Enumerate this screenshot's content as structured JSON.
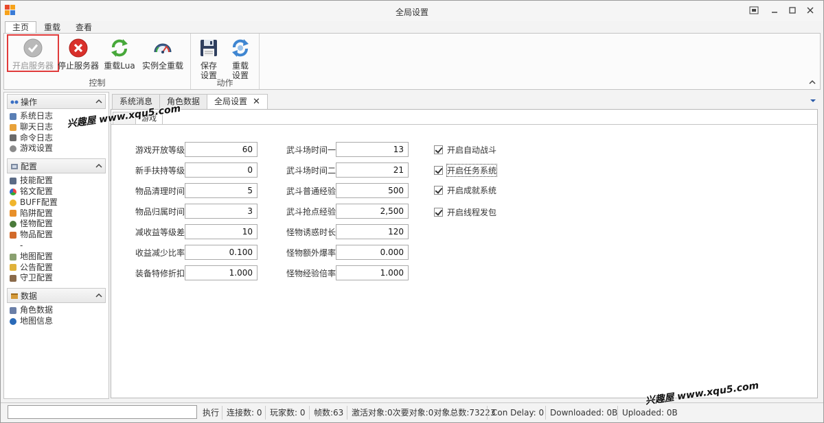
{
  "window": {
    "title": "全局设置"
  },
  "ribbon": {
    "tabs": [
      {
        "label": "主页",
        "active": true
      },
      {
        "label": "重载",
        "active": false
      },
      {
        "label": "查看",
        "active": false
      }
    ],
    "groups": {
      "control": {
        "label": "控制",
        "buttons": [
          {
            "label": "开启服务器",
            "icon": "check-circle-icon",
            "disabled": true
          },
          {
            "label": "停止服务器",
            "icon": "stop-x-icon",
            "disabled": false
          },
          {
            "label": "重载Lua",
            "icon": "refresh-green-icon",
            "disabled": false
          },
          {
            "label": "实例全重载",
            "icon": "speedometer-icon",
            "disabled": false
          }
        ]
      },
      "action": {
        "label": "动作",
        "buttons": [
          {
            "label1": "保存",
            "label2": "设置",
            "icon": "floppy-save-icon"
          },
          {
            "label1": "重载",
            "label2": "设置",
            "icon": "reload-settings-icon"
          }
        ]
      }
    }
  },
  "sidebar": {
    "groups": [
      {
        "title": "操作",
        "items": [
          "系统日志",
          "聊天日志",
          "命令日志",
          "游戏设置"
        ]
      },
      {
        "title": "配置",
        "items": [
          "技能配置",
          "铭文配置",
          "BUFF配置",
          "陷阱配置",
          "怪物配置",
          "物品配置",
          "-",
          "地图配置",
          "公告配置",
          "守卫配置"
        ]
      },
      {
        "title": "数据",
        "items": [
          "角色数据",
          "地图信息"
        ]
      }
    ]
  },
  "doc_tabs": [
    {
      "label": "系统消息",
      "active": false
    },
    {
      "label": "角色数据",
      "active": false
    },
    {
      "label": "全局设置",
      "active": true
    }
  ],
  "inner_tabs": [
    {
      "label": "",
      "active": false
    },
    {
      "label": "游戏",
      "active": true
    }
  ],
  "form": {
    "col1": [
      {
        "label": "游戏开放等级",
        "value": "60"
      },
      {
        "label": "新手扶持等级",
        "value": "0"
      },
      {
        "label": "物品清理时间",
        "value": "5"
      },
      {
        "label": "物品归属时间",
        "value": "3"
      },
      {
        "label": "减收益等级差",
        "value": "10"
      },
      {
        "label": "收益减少比率",
        "value": "0.100"
      },
      {
        "label": "装备特修折扣",
        "value": "1.000"
      }
    ],
    "col2": [
      {
        "label": "武斗场时间一",
        "value": "13"
      },
      {
        "label": "武斗场时间二",
        "value": "21"
      },
      {
        "label": "武斗普通经验",
        "value": "500"
      },
      {
        "label": "武斗抢点经验",
        "value": "2,500"
      },
      {
        "label": "怪物诱惑时长",
        "value": "120"
      },
      {
        "label": "怪物额外爆率",
        "value": "0.000"
      },
      {
        "label": "怪物经验倍率",
        "value": "1.000"
      }
    ],
    "checkboxes": [
      {
        "label": "开启自动战斗",
        "checked": true
      },
      {
        "label": "开启任务系统",
        "checked": true
      },
      {
        "label": "开启成就系统",
        "checked": true
      },
      {
        "label": "开启线程发包",
        "checked": true
      }
    ]
  },
  "statusbar": {
    "execute": "执行",
    "connections": "连接数: 0",
    "players": "玩家数: 0",
    "fps": "帧数:63",
    "objects": "激活对象:0次要对象:0对象总数:73223",
    "con_delay": "Con Delay: 0",
    "downloaded": "Downloaded: 0B",
    "uploaded": "Uploaded: 0B"
  },
  "watermarks": [
    "兴趣屋 www.xqu5.com",
    "兴趣屋 www.xqu5.com"
  ]
}
